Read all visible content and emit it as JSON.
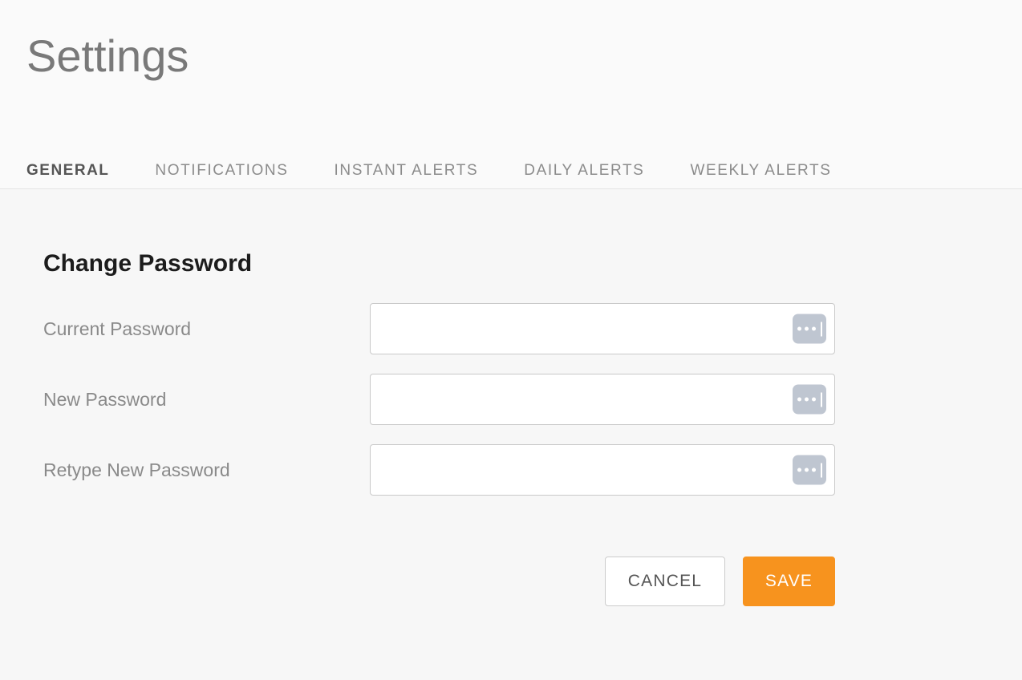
{
  "header": {
    "title": "Settings"
  },
  "tabs": [
    {
      "label": "GENERAL",
      "active": true
    },
    {
      "label": "NOTIFICATIONS",
      "active": false
    },
    {
      "label": "INSTANT ALERTS",
      "active": false
    },
    {
      "label": "DAILY ALERTS",
      "active": false
    },
    {
      "label": "WEEKLY ALERTS",
      "active": false
    }
  ],
  "main": {
    "section_title": "Change Password",
    "fields": [
      {
        "label": "Current Password",
        "value": "",
        "placeholder": "",
        "icon": "password-mask-icon"
      },
      {
        "label": "New Password",
        "value": "",
        "placeholder": "",
        "icon": "password-mask-icon"
      },
      {
        "label": "Retype New Password",
        "value": "",
        "placeholder": "",
        "icon": "password-mask-icon"
      }
    ],
    "actions": {
      "cancel_label": "CANCEL",
      "save_label": "SAVE"
    }
  },
  "colors": {
    "accent": "#f7931e",
    "header_bg": "#fafafa",
    "content_bg": "#f7f7f7",
    "title_text": "#797979",
    "active_tab_text": "#555555",
    "inactive_tab_text": "#8b8b8b",
    "label_text": "#8a8a8a",
    "section_title_text": "#1c1c1c",
    "input_border": "#c9c9c9",
    "icon_bg": "#bfc6d1"
  }
}
